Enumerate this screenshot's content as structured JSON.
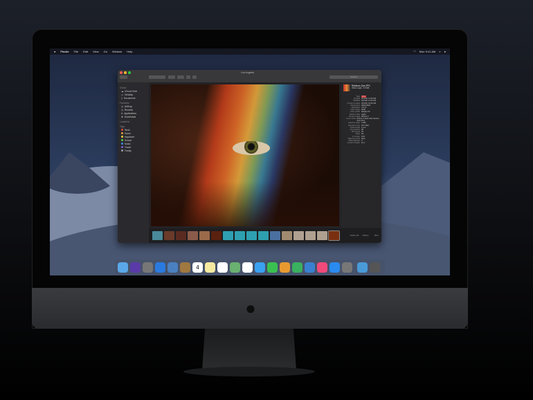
{
  "menubar": {
    "apple": "",
    "app": "Finder",
    "items": [
      "File",
      "Edit",
      "View",
      "Go",
      "Window",
      "Help"
    ],
    "clock": "Mon 9:41 AM"
  },
  "window": {
    "title": "Los Angeles",
    "search_placeholder": "Search"
  },
  "sidebar": {
    "sections": [
      {
        "header": "iCloud",
        "items": [
          "iCloud Drive",
          "Desktop",
          "Documents"
        ]
      },
      {
        "header": "Favorites",
        "items": [
          "AirDrop",
          "Recents",
          "Applications",
          "Downloads"
        ]
      },
      {
        "header": "Locations",
        "items": []
      },
      {
        "header": "Tags",
        "items": [
          "Work",
          "Home",
          "Important",
          "School",
          "Music",
          "Travel",
          "Family"
        ]
      }
    ],
    "tag_colors": [
      "#e0443e",
      "#f19a37",
      "#f5cf3e",
      "#5cc74c",
      "#3a8ef2",
      "#7b5cd6",
      "#9a9a9a"
    ]
  },
  "info": {
    "filename": "Rainbow_Eye.JPG",
    "subtitle": "JPEG image - 2.8 MB",
    "rows": [
      [
        "Tags",
        "Red"
      ],
      [
        "Created",
        "2/15/18, 11:26 AM"
      ],
      [
        "Modified",
        "2/15/18, 11:26 AM"
      ],
      [
        "Content created",
        "2/15/18, 10:02 AM"
      ],
      [
        "Dimensions",
        "4032×3024"
      ],
      [
        "Resolution",
        "72×72"
      ],
      [
        "Color space",
        "RGB"
      ],
      [
        "Color profile",
        "Display P3"
      ],
      [
        "Device make",
        "Apple"
      ],
      [
        "Device model",
        "iPhone X"
      ],
      [
        "Lens model",
        "iPhone X back dual camera 6mm f/2.4"
      ],
      [
        "Aperture value",
        "1.696"
      ],
      [
        "Exposure time",
        "1/17 SEC"
      ],
      [
        "Focal length",
        "4 mm"
      ],
      [
        "Alt exposure",
        "99"
      ],
      [
        "ISO speed",
        "25"
      ],
      [
        "Flash",
        "No"
      ],
      [
        "F number",
        "f/1.8"
      ],
      [
        "Metering mode",
        "Spot"
      ],
      [
        "White balance",
        "0"
      ],
      [
        "Content Creator",
        "11.2"
      ]
    ]
  },
  "strip": {
    "buttons": [
      "Rotate Left",
      "Markup",
      "More"
    ]
  },
  "dock": {
    "apps": [
      "Finder",
      "Siri",
      "Launchpad",
      "Safari",
      "Mail",
      "Contacts",
      "Calendar",
      "Notes",
      "Reminders",
      "Maps",
      "Photos",
      "Messages",
      "FaceTime",
      "Pages",
      "Numbers",
      "Keynote",
      "iTunes",
      "App Store",
      "System Preferences",
      "Downloads",
      "Trash"
    ],
    "calendar_day": "4"
  }
}
